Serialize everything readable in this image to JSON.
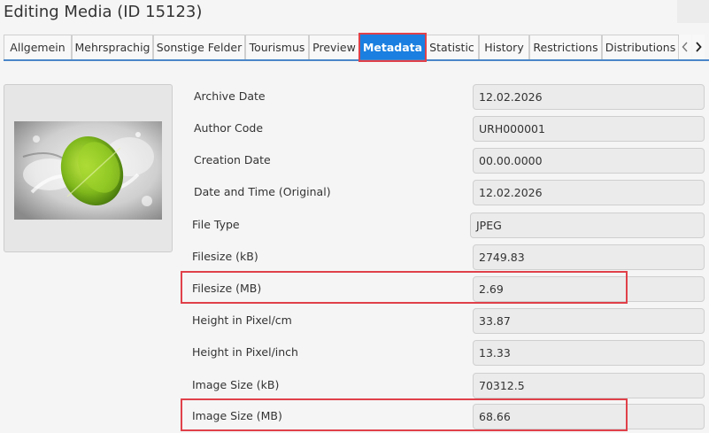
{
  "window": {
    "title": "Editing Media (ID 15123)"
  },
  "tabs": [
    {
      "label": "Allgemein"
    },
    {
      "label": "Mehrsprachig"
    },
    {
      "label": "Sonstige Felder"
    },
    {
      "label": "Tourismus"
    },
    {
      "label": "Preview"
    },
    {
      "label": "Metadata",
      "active": true
    },
    {
      "label": "Statistic"
    },
    {
      "label": "History"
    },
    {
      "label": "Restrictions"
    },
    {
      "label": "Distributions"
    }
  ],
  "tab_nav": {
    "prev_icon": "chevron-left-icon",
    "next_icon": "chevron-right-icon"
  },
  "preview": {
    "image": "lime-splash-photo"
  },
  "metadata": [
    {
      "label": "Archive Date",
      "value": "12.02.2026"
    },
    {
      "label": "Author Code",
      "value": "URH000001"
    },
    {
      "label": "Creation Date",
      "value": "00.00.0000"
    },
    {
      "label": "Date and Time (Original)",
      "value": "12.02.2026"
    },
    {
      "label": "File Type",
      "value": "JPEG"
    },
    {
      "label": "Filesize (kB)",
      "value": "2749.83"
    },
    {
      "label": "Filesize (MB)",
      "value": "2.69",
      "highlighted": true
    },
    {
      "label": "Height in Pixel/cm",
      "value": "33.87"
    },
    {
      "label": "Height in Pixel/inch",
      "value": "13.33"
    },
    {
      "label": "Image Size (kB)",
      "value": "70312.5"
    },
    {
      "label": "Image Size (MB)",
      "value": "68.66",
      "highlighted": true
    }
  ],
  "colors": {
    "active_tab": "#1a7fe0",
    "highlight": "#e0414a",
    "tab_underline": "#4a86c8"
  }
}
